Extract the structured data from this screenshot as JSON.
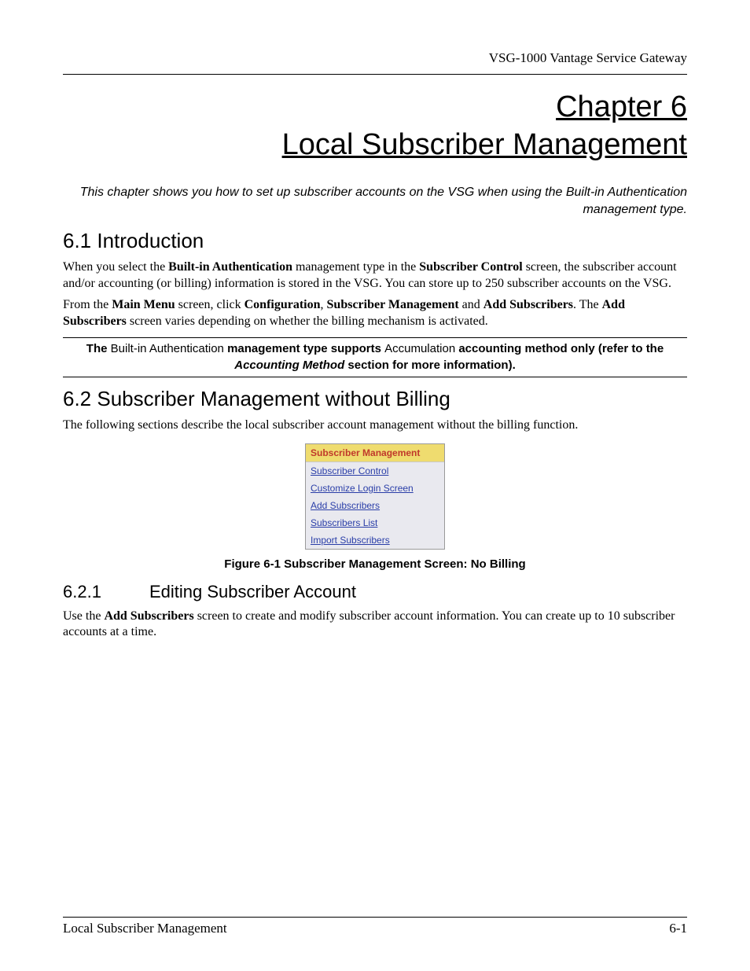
{
  "header": {
    "right": "VSG-1000 Vantage Service Gateway"
  },
  "chapter": {
    "line1": "Chapter 6",
    "line2": "Local Subscriber Management"
  },
  "intro_italic": "This chapter shows you how to set up subscriber accounts on the VSG when using the Built-in Authentication management type.",
  "section_6_1": {
    "heading": "6.1  Introduction",
    "p1_prefix": "When you select the ",
    "p1_b1": "Built-in Authentication",
    "p1_mid1": " management type in the ",
    "p1_b2": "Subscriber Control",
    "p1_suffix": " screen, the subscriber account and/or accounting (or billing) information is stored in the VSG. You can store up to 250 subscriber accounts on the VSG.",
    "p2_prefix": "From the ",
    "p2_b1": "Main Menu",
    "p2_mid1": " screen, click ",
    "p2_b2": "Configuration",
    "p2_sep1": ", ",
    "p2_b3": "Subscriber Management",
    "p2_sep2": " and ",
    "p2_b4": "Add Subscribers",
    "p2_sep3": ". The ",
    "p2_b5": "Add Subscribers",
    "p2_suffix": " screen varies depending on whether the billing mechanism is activated."
  },
  "note": {
    "t1": "The ",
    "n1": "Built-in Authentication ",
    "t2": "management type supports ",
    "n2": "Accumulation ",
    "t3": "accounting method only (refer to the ",
    "bi1": "Accounting Method",
    "t4": " section for more information)."
  },
  "section_6_2": {
    "heading": "6.2  Subscriber Management without Billing",
    "p1": "The following sections describe the local subscriber account management without the billing function."
  },
  "menu": {
    "header": "Subscriber Management",
    "items": [
      "Subscriber Control",
      "Customize Login Screen",
      "Add Subscribers",
      "Subscribers List",
      "Import Subscribers"
    ]
  },
  "figure_caption": "Figure 6-1 Subscriber Management Screen: No Billing",
  "section_6_2_1": {
    "num": "6.2.1",
    "title": "Editing Subscriber Account",
    "p1_prefix": "Use the ",
    "p1_b1": "Add Subscribers",
    "p1_suffix": " screen to create and modify subscriber account information. You can create up to 10 subscriber accounts at a time."
  },
  "footer": {
    "left": "Local Subscriber Management",
    "right": "6-1"
  }
}
